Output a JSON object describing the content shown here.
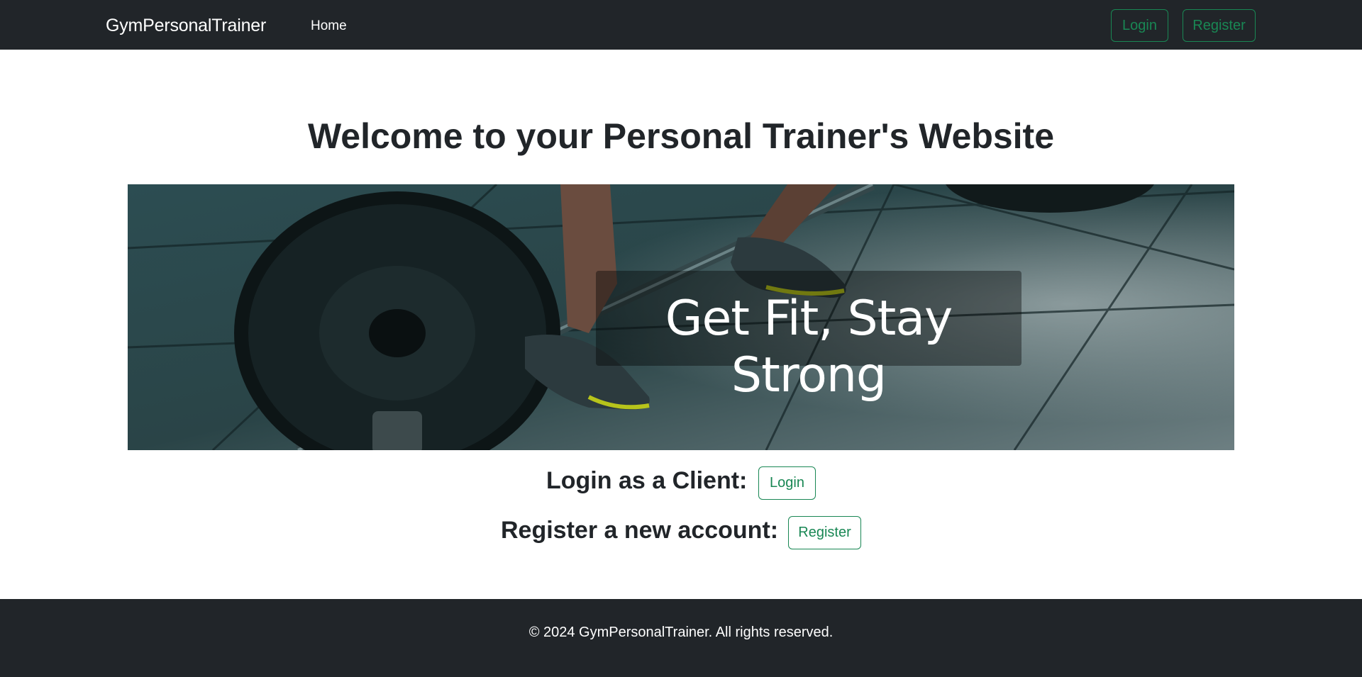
{
  "navbar": {
    "brand": "GymPersonalTrainer",
    "home_label": "Home",
    "login_label": "Login",
    "register_label": "Register"
  },
  "main": {
    "title": "Welcome to your Personal Trainer's Website",
    "hero": {
      "caption": "Get Fit, Stay Strong",
      "image_description": "gym floor with barbell and athlete's shoes"
    },
    "client_row": {
      "label": "Login as a Client:",
      "button_label": "Login"
    },
    "register_row": {
      "label": "Register a new account:",
      "button_label": "Register"
    }
  },
  "footer": {
    "copyright": "© 2024 GymPersonalTrainer. All rights reserved."
  },
  "colors": {
    "navbar_bg": "#212529",
    "accent_green": "#198754",
    "text_dark": "#212529"
  }
}
